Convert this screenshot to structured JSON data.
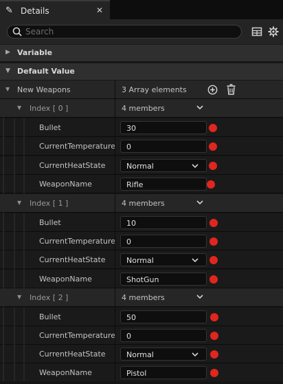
{
  "tab": {
    "title": "Details"
  },
  "search": {
    "placeholder": "Search"
  },
  "categories": {
    "variable": "Variable",
    "default_value": "Default Value"
  },
  "array": {
    "name": "New Weapons",
    "summary": "3 Array elements"
  },
  "elements": [
    {
      "index_label": "Index [ 0 ]",
      "summary": "4 members",
      "labels": {
        "bullet": "Bullet",
        "temp": "CurrentTemperature",
        "heat": "CurrentHeatState",
        "name": "WeaponName"
      },
      "values": {
        "bullet": "30",
        "temp": "0",
        "heat": "Normal",
        "name": "Rifle"
      }
    },
    {
      "index_label": "Index [ 1 ]",
      "summary": "4 members",
      "labels": {
        "bullet": "Bullet",
        "temp": "CurrentTemperature",
        "heat": "CurrentHeatState",
        "name": "WeaponName"
      },
      "values": {
        "bullet": "10",
        "temp": "0",
        "heat": "Normal",
        "name": "ShotGun"
      }
    },
    {
      "index_label": "Index [ 2 ]",
      "summary": "4 members",
      "labels": {
        "bullet": "Bullet",
        "temp": "CurrentTemperature",
        "heat": "CurrentHeatState",
        "name": "WeaponName"
      },
      "values": {
        "bullet": "50",
        "temp": "0",
        "heat": "Normal",
        "name": "Pistol"
      }
    }
  ],
  "icons": {
    "tab": "pencil-icon",
    "close": "close-icon",
    "search": "search-icon",
    "table_view": "table-view-icon",
    "settings": "gear-icon",
    "add": "add-element-icon",
    "delete": "trash-icon",
    "pin": "pin-icon"
  },
  "colors": {
    "pin": "#e0261f",
    "panel": "#1a1a1a",
    "header": "#2f2f2f"
  }
}
